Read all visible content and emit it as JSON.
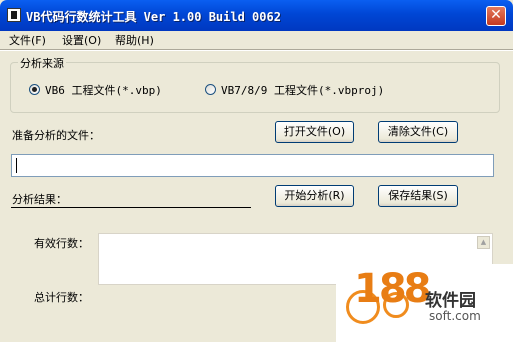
{
  "window": {
    "title": "VB代码行数统计工具 Ver 1.00 Build 0062",
    "close_glyph": "✕"
  },
  "menu": {
    "items": [
      {
        "label": "文件(F)"
      },
      {
        "label": "设置(O)"
      },
      {
        "label": "帮助(H)"
      }
    ]
  },
  "source_group": {
    "legend": "分析来源",
    "options": [
      {
        "label": "VB6 工程文件(*.vbp)",
        "checked": true
      },
      {
        "label": "VB7/8/9 工程文件(*.vbproj)",
        "checked": false
      }
    ]
  },
  "files": {
    "label": "准备分析的文件：",
    "open_button": "打开文件(O)",
    "clear_button": "清除文件(C)",
    "path_value": ""
  },
  "results": {
    "label": "分析结果：",
    "start_button": "开始分析(R)",
    "save_button": "保存结果(S)",
    "valid_lines_label": "有效行数：",
    "total_lines_label": "总计行数："
  },
  "watermark": {
    "number": "188",
    "name": "软件园",
    "site": "soft.com"
  },
  "colors": {
    "titlebar": "#0046d5",
    "window_bg": "#ece9d8",
    "close_button": "#c4391f",
    "watermark_orange": "#e87d14"
  }
}
